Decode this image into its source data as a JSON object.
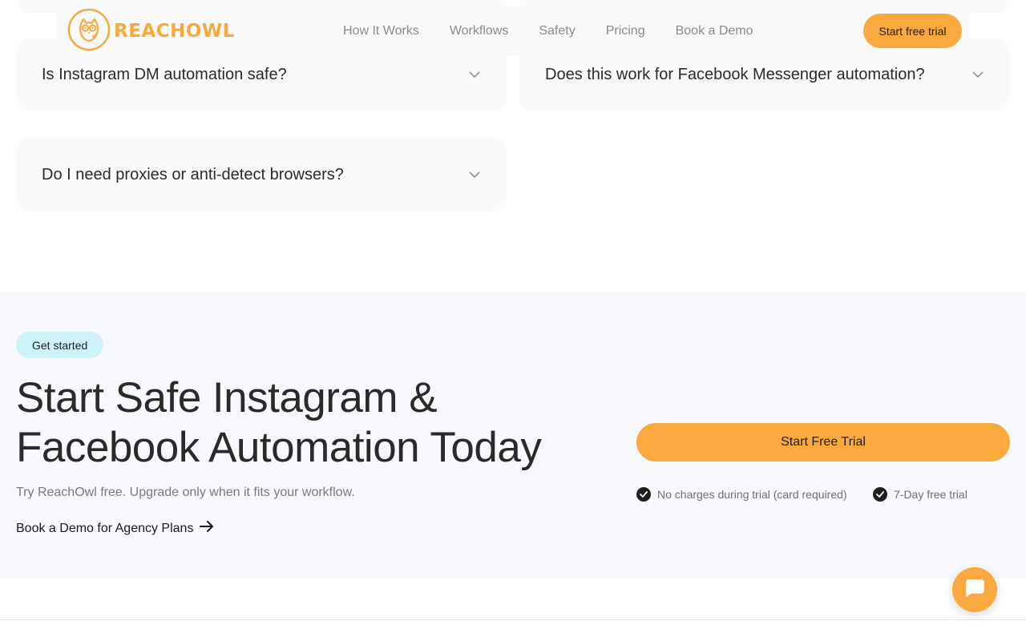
{
  "brand": {
    "name": "REACHOWL",
    "accent_color": "#f9a93e"
  },
  "nav": {
    "links": [
      {
        "label": "How It Works"
      },
      {
        "label": "Workflows"
      },
      {
        "label": "Safety"
      },
      {
        "label": "Pricing"
      },
      {
        "label": "Book a Demo"
      }
    ],
    "cta_label": "Start free trial"
  },
  "faq": {
    "items": [
      {
        "question": "Is Instagram DM automation safe?"
      },
      {
        "question": "Does this work for Facebook Messenger automation?"
      },
      {
        "question": "Do I need proxies or anti-detect browsers?"
      }
    ],
    "chevron_icon": "chevron-down-icon"
  },
  "get_started": {
    "pill": "Get started",
    "headline": "Start Safe Instagram & Facebook Automation Today",
    "subline": "Try ReachOwl free. Upgrade only when it fits your workflow.",
    "demo_link": "Book a Demo for Agency Plans",
    "cta_label": "Start Free Trial",
    "perks": [
      {
        "label": "No charges during trial (card required)"
      },
      {
        "label": "7-Day free trial"
      }
    ],
    "pill_color": "#cdf3f8"
  },
  "chat": {
    "icon": "chat-bubble-icon"
  }
}
